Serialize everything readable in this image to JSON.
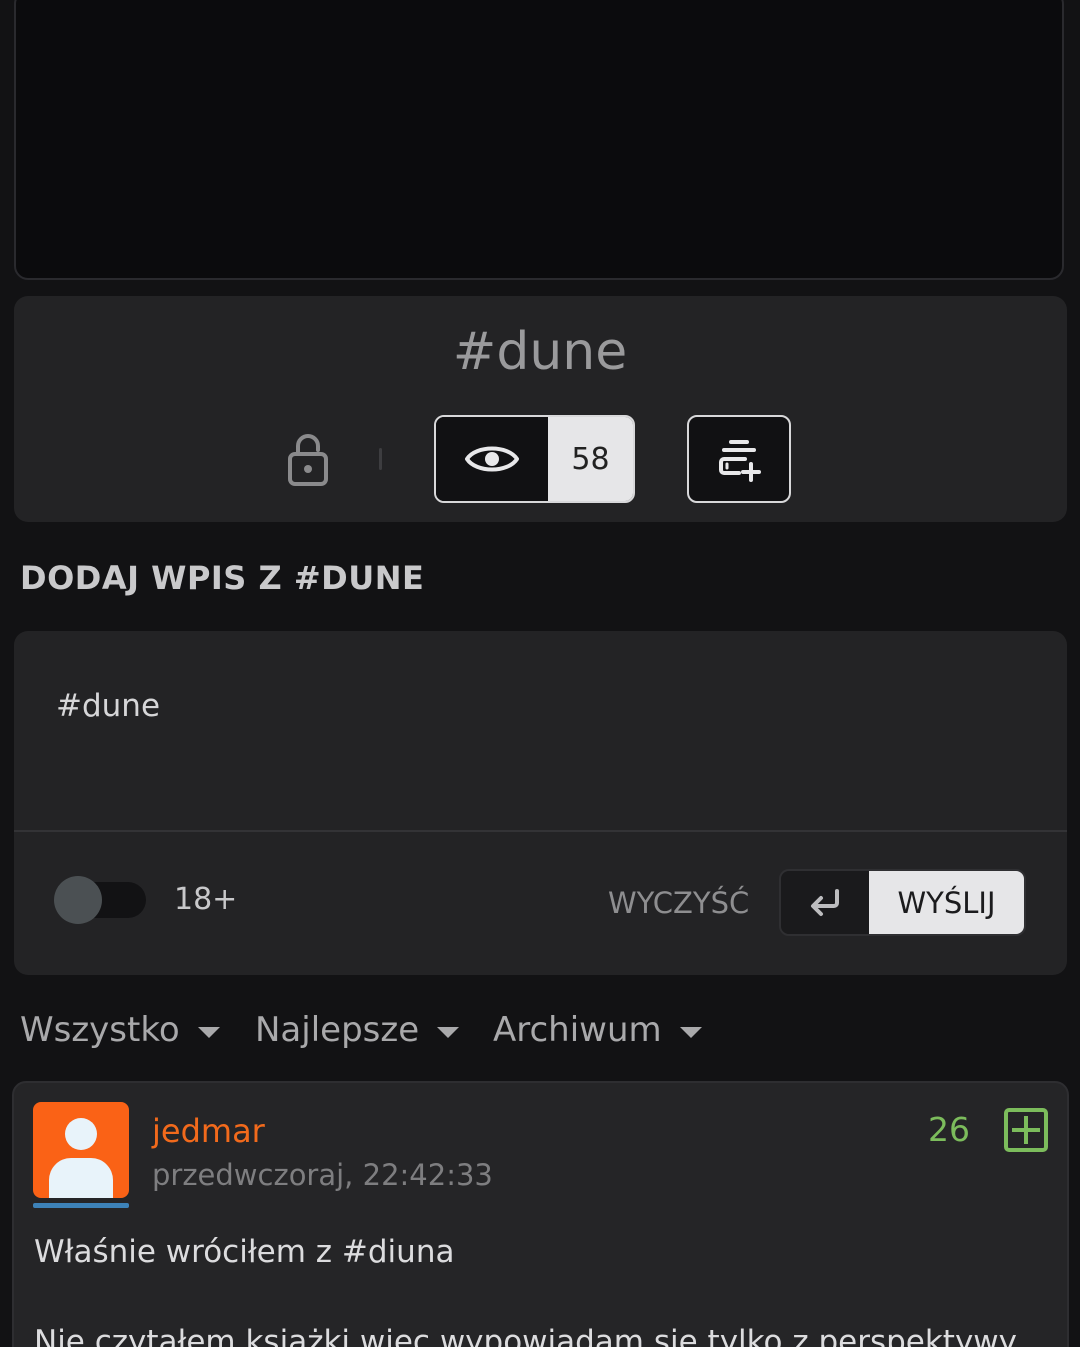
{
  "tag": {
    "title": "#dune",
    "observers_count": "58"
  },
  "composer": {
    "heading": "DODAJ WPIS Z #DUNE",
    "text": "#dune",
    "adult_label": "18+",
    "clear_label": "WYCZYŚĆ",
    "send_label": "WYŚLIJ"
  },
  "filters": {
    "all": "Wszystko",
    "best": "Najlepsze",
    "archive": "Archiwum"
  },
  "post": {
    "author": "jedmar",
    "date": "przedwczoraj, 22:42:33",
    "votes": "26",
    "line1_prefix": "Właśnie wróciłem z ",
    "line1_tag": "#diuna",
    "line2": "Nie czytałem książki więc wypowiadam się tylko z perspektywy"
  },
  "colors": {
    "background": "#121214",
    "card": "#232325",
    "avatar": "#fa6216",
    "author": "#f26a1c",
    "vote": "#7cbc5c",
    "avatar_underline": "#3d82b8"
  },
  "icons": {
    "lock": "lock-icon",
    "observe": "eye-icon",
    "blacklist": "stack-plus-icon",
    "enter": "enter-key-icon",
    "vote": "plus-square-icon",
    "avatar": "user-silhouette-icon"
  }
}
